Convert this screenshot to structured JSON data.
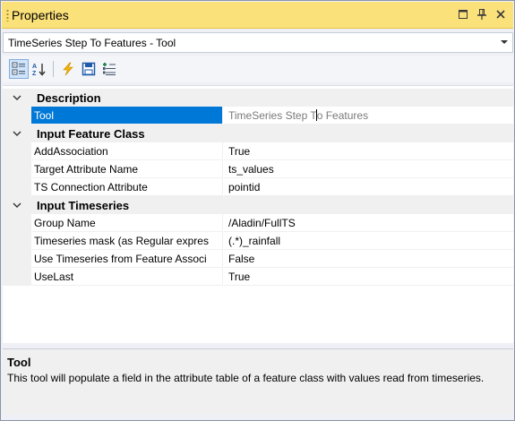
{
  "window": {
    "title": "Properties"
  },
  "selector": {
    "value": "TimeSeries Step To Features - Tool"
  },
  "toolbar": {
    "buttons": [
      {
        "icon": "categorized-icon"
      },
      {
        "icon": "alphabetical-icon"
      },
      {
        "icon": "events-lightning-icon"
      },
      {
        "icon": "save-icon"
      },
      {
        "icon": "add-property-icon"
      }
    ]
  },
  "grid": {
    "categories": [
      {
        "label": "Description",
        "properties": [
          {
            "name": "Tool",
            "value_before_caret": "TimeSeries Step T",
            "value_after_caret": "o Features"
          }
        ]
      },
      {
        "label": "Input Feature Class",
        "properties": [
          {
            "name": "AddAssociation",
            "value": "True"
          },
          {
            "name": "Target Attribute Name",
            "value": "ts_values"
          },
          {
            "name": "TS Connection Attribute",
            "value": "pointid"
          }
        ]
      },
      {
        "label": "Input Timeseries",
        "properties": [
          {
            "name": "Group Name",
            "value": "/Aladin/FullTS"
          },
          {
            "name": "Timeseries mask (as Regular expres",
            "value": "(.*)_rainfall"
          },
          {
            "name": "Use Timeseries from Feature Associ",
            "value": "False"
          },
          {
            "name": "UseLast",
            "value": "True"
          }
        ]
      }
    ]
  },
  "help": {
    "title": "Tool",
    "description": "This tool will populate a field in the attribute table of a feature class with values read from timeseries."
  },
  "colors": {
    "title_bar": "#fbe17a",
    "selection": "#0078d7",
    "category_bg": "#f0f0f0"
  }
}
